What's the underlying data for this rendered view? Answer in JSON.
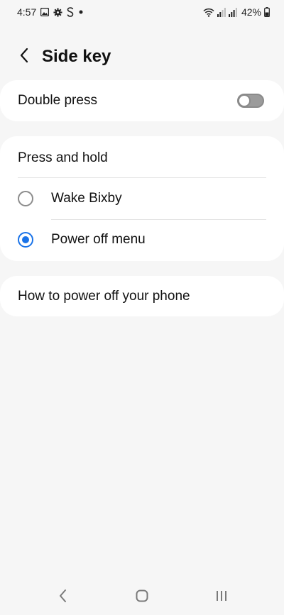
{
  "status_bar": {
    "time": "4:57",
    "battery": "42%",
    "left_icons": [
      "gallery-icon",
      "settings-gear-icon",
      "s-icon",
      "dot-icon"
    ],
    "right_icons": [
      "wifi-icon",
      "signal-icon",
      "signal-icon-2",
      "battery-icon"
    ]
  },
  "header": {
    "title": "Side key"
  },
  "double_press": {
    "label": "Double press",
    "toggle_on": false
  },
  "press_and_hold": {
    "title": "Press and hold",
    "options": [
      {
        "label": "Wake Bixby",
        "selected": false
      },
      {
        "label": "Power off menu",
        "selected": true
      }
    ]
  },
  "help_link": {
    "label": "How to power off your phone"
  },
  "colors": {
    "accent": "#1a73e8",
    "background": "#f6f6f6",
    "card": "#ffffff"
  },
  "nav_bar": {
    "icons": [
      "back-icon",
      "home-icon",
      "recents-icon"
    ]
  }
}
